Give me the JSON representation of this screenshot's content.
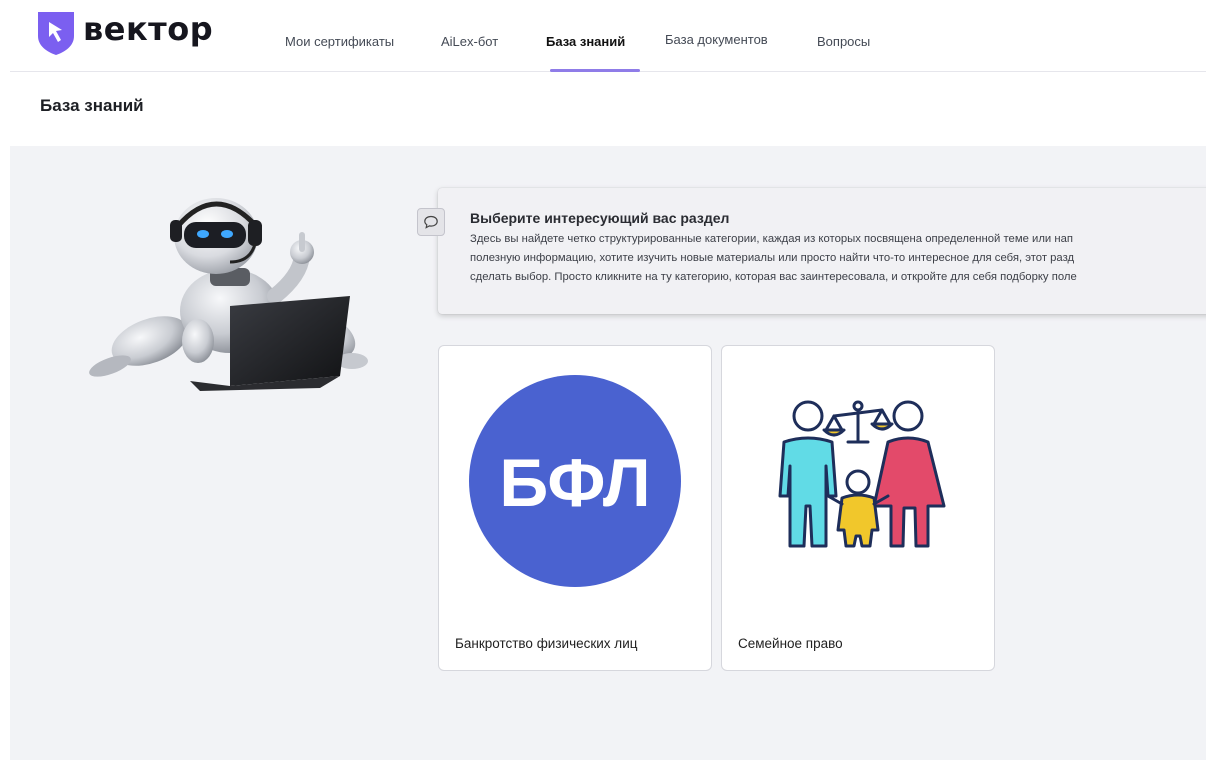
{
  "brand": {
    "name": "вектор",
    "accent": "#7b5ff0"
  },
  "nav": {
    "items": [
      {
        "label": "Мои сертификаты"
      },
      {
        "label": "AiLex-бот"
      },
      {
        "label": "База знаний"
      },
      {
        "label": "База документов"
      },
      {
        "label": "Вопросы"
      }
    ],
    "active": "База знаний",
    "underline_color": "#8f7ce8"
  },
  "page": {
    "title": "База знаний"
  },
  "info": {
    "title": "Выберите интересующий вас раздел",
    "lines": [
      "Здесь вы найдете четко структурированные категории, каждая из которых посвящена определенной теме или нап",
      "полезную информацию, хотите изучить новые материалы или просто найти что-то интересное для себя, этот разд",
      "сделать выбор. Просто кликните на ту категорию, которая вас заинтересовала, и откройте для себя подборку поле"
    ]
  },
  "cards": [
    {
      "label": "Банкротство физических лиц",
      "image_text": "БФЛ",
      "image_color": "#4a62d0",
      "icon": "bfl-logo-icon"
    },
    {
      "label": "Семейное право",
      "icon": "family-law-icon"
    }
  ],
  "icons": {
    "chat": "chat-bubble-icon",
    "robot": "robot-illustration-icon",
    "logo": "vector-logo-icon"
  }
}
